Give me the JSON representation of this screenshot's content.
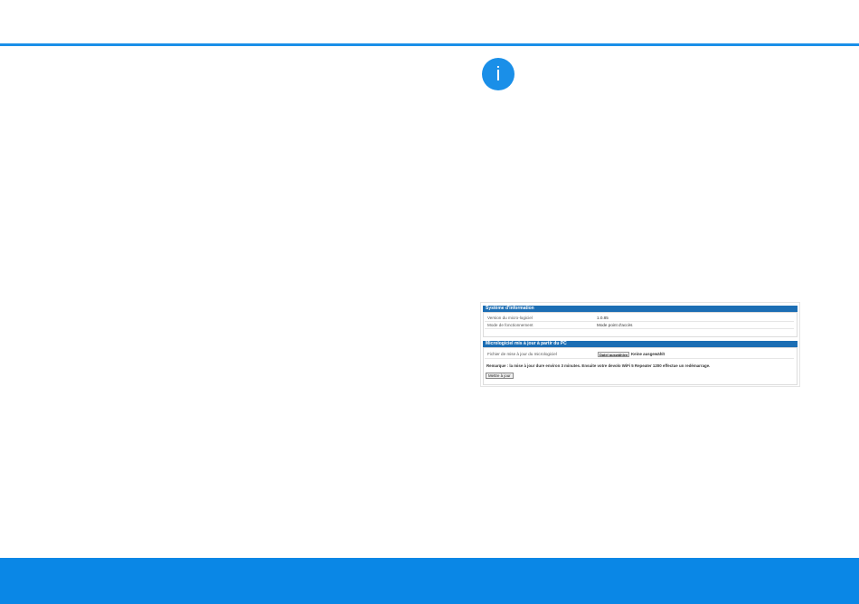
{
  "colors": {
    "accent": "#1a8fe8",
    "bottom_band": "#0a87e6",
    "panel_header": "#1c6eb4"
  },
  "info_icon": {
    "icon": "info-icon",
    "glyph": "i"
  },
  "system_info": {
    "title": "Système d'information",
    "rows": [
      {
        "label": "Version du micro-logiciel",
        "value": "1.0.85"
      },
      {
        "label": "Mode de fonctionnement",
        "value": "Mode point d'accès"
      }
    ]
  },
  "firmware_update": {
    "title": "Micrologiciel mis à jour à partir du PC",
    "file_label": "Fichier de mise à jour du micrologiciel",
    "choose_button": "Datei auswählen",
    "file_status": "Keine ausgewählt",
    "note": "Remarque : la mise à jour dure environ 3 minutes. Ensuite votre devolo WiFi 5 Repeater 1200 effectue un redémarrage.",
    "update_button": "Mettre à jour"
  }
}
